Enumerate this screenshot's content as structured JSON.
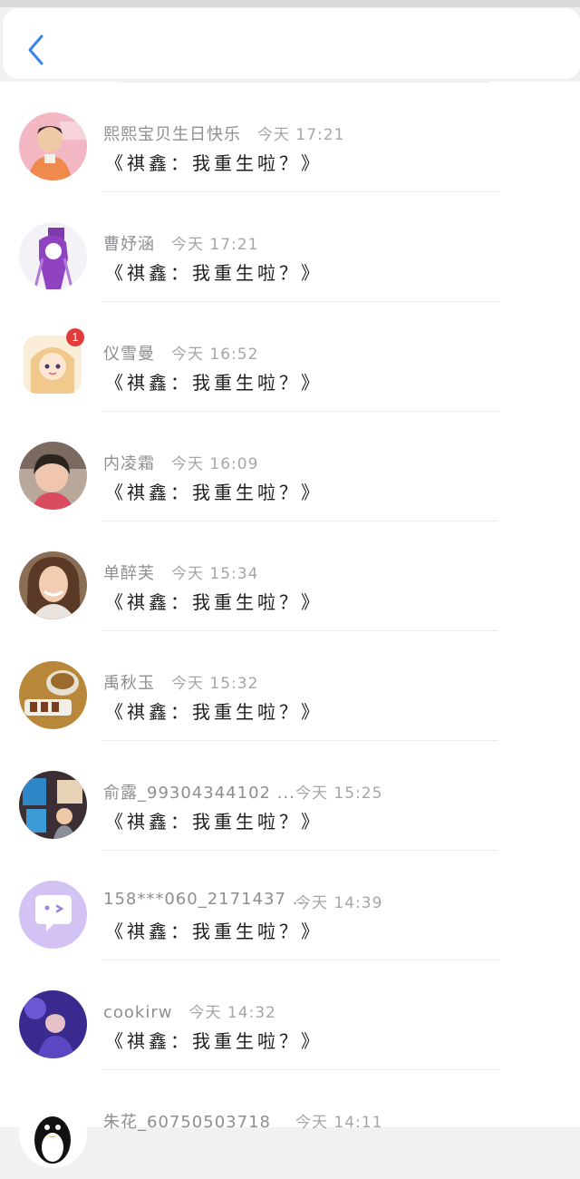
{
  "header": {
    "back_icon": "chevron-left-icon"
  },
  "colors": {
    "accent": "#3b82f6",
    "badge": "#e33a3a"
  },
  "message_text": "《祺鑫：我重生啦？》",
  "conversations": [
    {
      "name": "熙熙宝贝生日快乐",
      "time": "今天 17:21",
      "message": "《祺鑫：我重生啦？》",
      "avatar": "avatar-photo-pink"
    },
    {
      "name": "曹妤涵",
      "time": "今天 17:21",
      "message": "《祺鑫：我重生啦？》",
      "avatar": "avatar-anime-purple"
    },
    {
      "name": "仪雪曼",
      "time": "今天 16:52",
      "message": "《祺鑫：我重生啦？》",
      "avatar": "avatar-anime-girl",
      "badge": "1"
    },
    {
      "name": "内凌霜",
      "time": "今天 16:09",
      "message": "《祺鑫：我重生啦？》",
      "avatar": "avatar-photo-child"
    },
    {
      "name": "单醉芙",
      "time": "今天 15:34",
      "message": "《祺鑫：我重生啦？》",
      "avatar": "avatar-photo-woman"
    },
    {
      "name": "禹秋玉",
      "time": "今天 15:32",
      "message": "《祺鑫：我重生啦？》",
      "avatar": "avatar-photo-food"
    },
    {
      "name": "俞露_99304344102 ...",
      "time": "今天 15:25",
      "message": "《祺鑫：我重生啦？》",
      "avatar": "avatar-photo-books"
    },
    {
      "name": "158***060_2171437 ...",
      "time": "今天 14:39",
      "message": "《祺鑫：我重生啦？》",
      "avatar": "avatar-chat-bubble"
    },
    {
      "name": "cookirw",
      "time": "今天 14:32",
      "message": "《祺鑫：我重生啦？》",
      "avatar": "avatar-photo-night"
    },
    {
      "name": "朱花_60750503718",
      "time": "今天 14:11",
      "message": "",
      "avatar": "avatar-penguin"
    }
  ]
}
